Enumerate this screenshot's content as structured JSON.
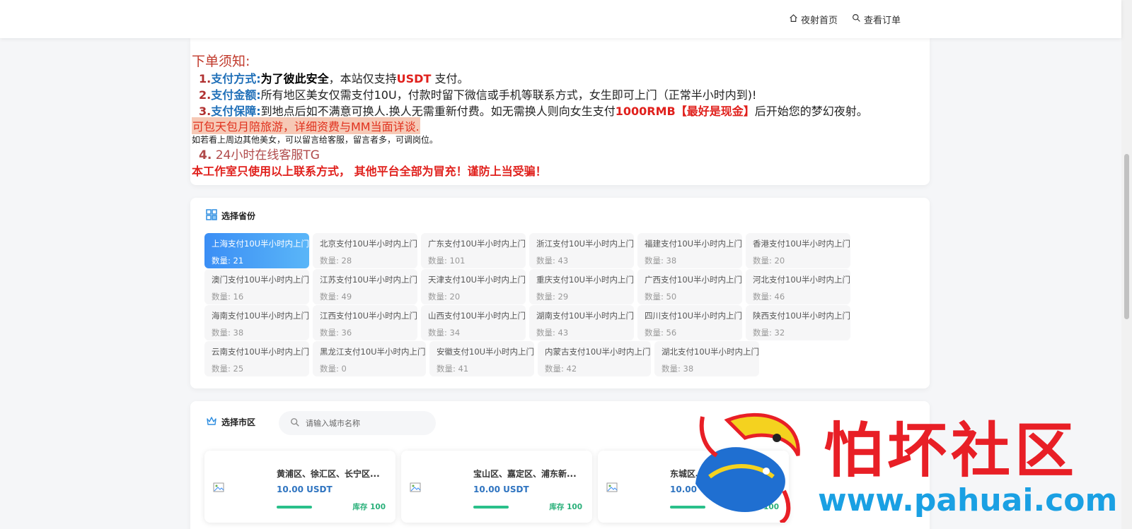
{
  "nav": {
    "home_label": "夜射首页",
    "orders_label": "查看订单"
  },
  "notice": {
    "title": "下单须知:",
    "line1": {
      "num": "1.",
      "key": "支付方式:",
      "bold": "为了彼此安全",
      "text1": "，本站仅支持",
      "red": "USDT",
      "text2": " 支付。"
    },
    "line2": {
      "num": "2.",
      "key": "支付金额:",
      "text": "所有地区美女仅需支付10U，付款时留下微信或手机等联系方式，女生即可上门（正常半小时内到)!"
    },
    "line3": {
      "num": "3.",
      "key": "支付保障:",
      "text1": "到地点后如不满意可换人.换人无需重新付费。如无需换人则向女生支付",
      "red": "1000RMB【最好是现金】",
      "text2": "后开始您的梦幻夜射。"
    },
    "highlight": "可包天包月陪旅游，详细资费与MM当面详谈.",
    "small": "如若看上周边其他美女，可以留言给客服，留言者多，可调岗位。",
    "tg_num": "4.",
    "tg_text": " 24小时在线客服TG",
    "warning": "本工作室只使用以上联系方式，  其他平台全部为冒充！谨防上当受骗！"
  },
  "province_section": {
    "title": "选择省份",
    "count_label": "数量:",
    "items": [
      {
        "name": "上海支付10U半小时内上门",
        "count": "21",
        "active": true
      },
      {
        "name": "北京支付10U半小时内上门",
        "count": "28"
      },
      {
        "name": "广东支付10U半小时内上门",
        "count": "101"
      },
      {
        "name": "浙江支付10U半小时内上门",
        "count": "43"
      },
      {
        "name": "福建支付10U半小时内上门",
        "count": "38"
      },
      {
        "name": "香港支付10U半小时内上门",
        "count": "20"
      },
      {
        "name": "澳门支付10U半小时内上门",
        "count": "16"
      },
      {
        "name": "江苏支付10U半小时内上门",
        "count": "49"
      },
      {
        "name": "天津支付10U半小时内上门",
        "count": "20"
      },
      {
        "name": "重庆支付10U半小时内上门",
        "count": "29"
      },
      {
        "name": "广西支付10U半小时内上门",
        "count": "50"
      },
      {
        "name": "河北支付10U半小时内上门",
        "count": "46"
      },
      {
        "name": "海南支付10U半小时内上门",
        "count": "38"
      },
      {
        "name": "江西支付10U半小时内上门",
        "count": "36"
      },
      {
        "name": "山西支付10U半小时内上门",
        "count": "34"
      },
      {
        "name": "湖南支付10U半小时内上门",
        "count": "43"
      },
      {
        "name": "四川支付10U半小时内上门",
        "count": "56"
      },
      {
        "name": "陕西支付10U半小时内上门",
        "count": "32"
      },
      {
        "name": "云南支付10U半小时内上门",
        "count": "25"
      },
      {
        "name": "黑龙江支付10U半小时内上门",
        "count": "0"
      },
      {
        "name": "安徽支付10U半小时内上门",
        "count": "41"
      },
      {
        "name": "内蒙古支付10U半小时内上门",
        "count": "42"
      },
      {
        "name": "湖北支付10U半小时内上门",
        "count": "38"
      }
    ]
  },
  "city_section": {
    "title": "选择市区",
    "search_placeholder": "请输入城市名称",
    "products": [
      {
        "name": "黄浦区、徐汇区、长宁区...",
        "price": "10.00 USDT",
        "stock": "库存 100",
        "stock_level": 1.0
      },
      {
        "name": "宝山区、嘉定区、浦东新...",
        "price": "10.00 USDT",
        "stock": "库存 100",
        "stock_level": 1.0
      },
      {
        "name": "东城区、西城区...",
        "price": "10.00 USDT",
        "stock": "库存 100",
        "stock_level": 1.0
      }
    ]
  },
  "watermark": {
    "title": "怕坏社区",
    "url": "www.pahuai.com"
  },
  "colors": {
    "accent": "#3b8ef5",
    "alert_red": "#e0201c",
    "stock_green": "#2ab07a",
    "price_blue": "#2f74c0"
  }
}
